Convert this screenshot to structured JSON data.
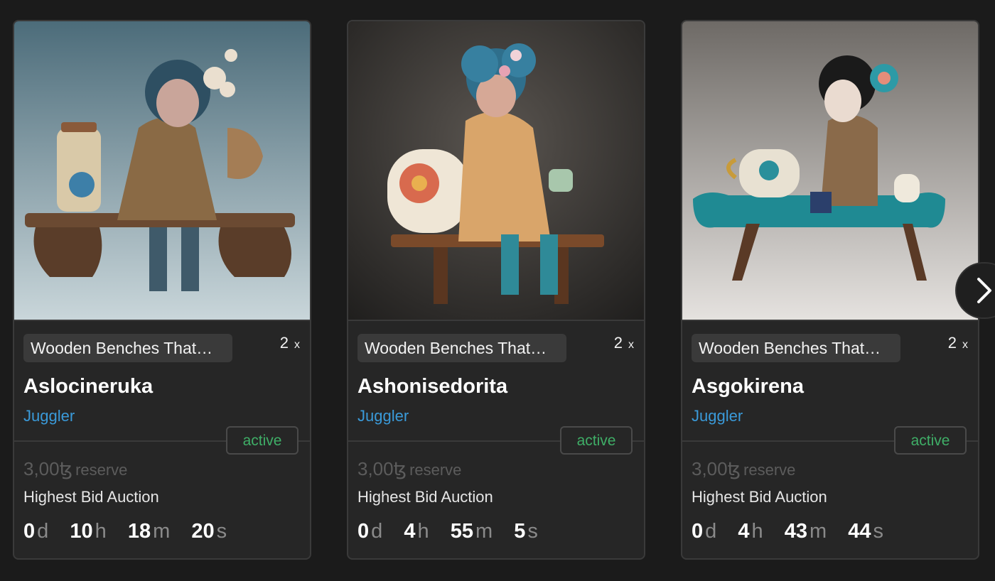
{
  "cards": [
    {
      "collection": "Wooden Benches That…",
      "editions": "2",
      "editions_x": "x",
      "title": "Aslocineruka",
      "artist": "Juggler",
      "status": "active",
      "reserve_amount": "3,00ꜩ",
      "reserve_label": "reserve",
      "auction_type": "Highest Bid Auction",
      "countdown": {
        "d": "0",
        "h": "10",
        "m": "18",
        "s": "20"
      }
    },
    {
      "collection": "Wooden Benches That…",
      "editions": "2",
      "editions_x": "x",
      "title": "Ashonisedorita",
      "artist": "Juggler",
      "status": "active",
      "reserve_amount": "3,00ꜩ",
      "reserve_label": "reserve",
      "auction_type": "Highest Bid Auction",
      "countdown": {
        "d": "0",
        "h": "4",
        "m": "55",
        "s": "5"
      }
    },
    {
      "collection": "Wooden Benches That…",
      "editions": "2",
      "editions_x": "x",
      "title": "Asgokirena",
      "artist": "Juggler",
      "status": "active",
      "reserve_amount": "3,00ꜩ",
      "reserve_label": "reserve",
      "auction_type": "Highest Bid Auction",
      "countdown": {
        "d": "0",
        "h": "4",
        "m": "43",
        "s": "44"
      }
    }
  ],
  "units": {
    "d": "d",
    "h": "h",
    "m": "m",
    "s": "s"
  },
  "nav": {
    "next_icon": "chevron-right-icon"
  },
  "colors": {
    "accent_link": "#3a9ad9",
    "status_active": "#3fae67",
    "card_bg": "#262626"
  }
}
